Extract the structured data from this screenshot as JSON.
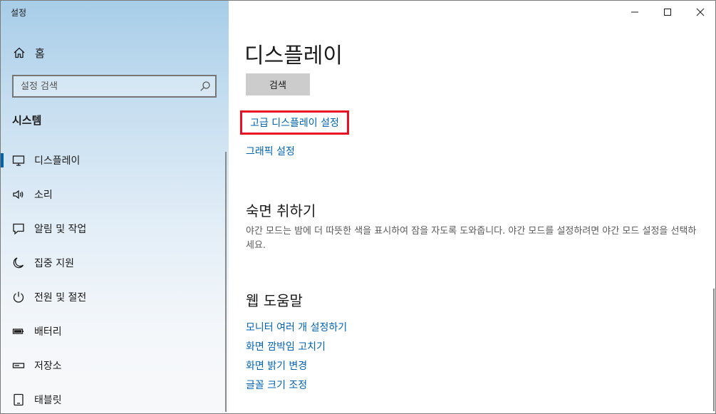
{
  "window": {
    "title": "설정",
    "controls": [
      "minimize",
      "maximize",
      "close"
    ]
  },
  "sidebar": {
    "home_label": "홈",
    "search_placeholder": "설정 검색",
    "section_title": "시스템",
    "items": [
      {
        "label": "디스플레이",
        "icon": "monitor-icon",
        "selected": true
      },
      {
        "label": "소리",
        "icon": "speaker-icon",
        "selected": false
      },
      {
        "label": "알림 및 작업",
        "icon": "notification-icon",
        "selected": false
      },
      {
        "label": "집중 지원",
        "icon": "moon-icon",
        "selected": false
      },
      {
        "label": "전원 및 절전",
        "icon": "power-icon",
        "selected": false
      },
      {
        "label": "배터리",
        "icon": "battery-icon",
        "selected": false
      },
      {
        "label": "저장소",
        "icon": "storage-icon",
        "selected": false
      },
      {
        "label": "태블릿",
        "icon": "tablet-icon",
        "selected": false
      }
    ]
  },
  "main": {
    "page_title": "디스플레이",
    "search_button": "검색",
    "advanced_display_link": "고급 디스플레이 설정",
    "graphics_link": "그래픽 설정",
    "sleep_section": {
      "title": "숙면 취하기",
      "description": "야간 모드는 밤에 더 따뜻한 색을 표시하여 잠을 자도록 도와줍니다. 야간 모드를 설정하려면 야간 모드 설정을 선택하세요."
    },
    "web_help": {
      "title": "웹 도움말",
      "links": [
        "모니터 여러 개 설정하기",
        "화면 깜박임 고치기",
        "화면 밝기 변경",
        "글꼴 크기 조정"
      ]
    }
  },
  "colors": {
    "accent": "#0063b1",
    "highlight_border": "#e81123",
    "button_gray": "#cccccc"
  }
}
